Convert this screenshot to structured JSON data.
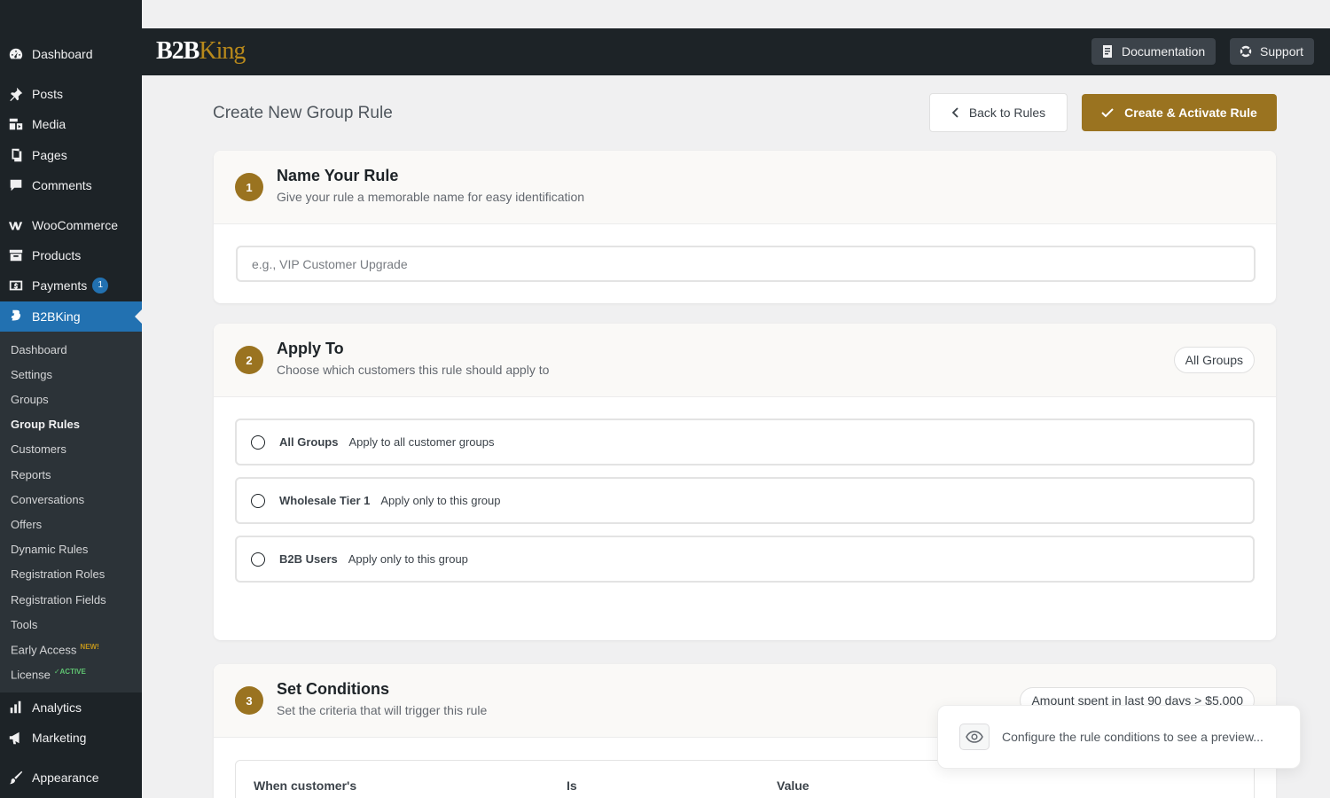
{
  "sidebar": {
    "top_items": [
      {
        "label": "Dashboard",
        "icon": "dashboard-icon"
      },
      {
        "label": "Posts",
        "icon": "pin-icon"
      },
      {
        "label": "Media",
        "icon": "media-icon"
      },
      {
        "label": "Pages",
        "icon": "pages-icon"
      },
      {
        "label": "Comments",
        "icon": "comment-icon"
      },
      {
        "label": "WooCommerce",
        "icon": "woo-icon"
      },
      {
        "label": "Products",
        "icon": "archive-icon"
      },
      {
        "label": "Payments",
        "icon": "payments-icon",
        "badge": "1"
      },
      {
        "label": "B2BKing",
        "icon": "b2bking-icon"
      }
    ],
    "submenu": [
      "Dashboard",
      "Settings",
      "Groups",
      "Group Rules",
      "Customers",
      "Reports",
      "Conversations",
      "Offers",
      "Dynamic Rules",
      "Registration Roles",
      "Registration Fields",
      "Tools",
      "Early Access",
      "License"
    ],
    "early_access_tag": "NEW!",
    "license_tag": "✓ACTIVE",
    "bottom_items": [
      {
        "label": "Analytics",
        "icon": "chart-icon"
      },
      {
        "label": "Marketing",
        "icon": "megaphone-icon"
      },
      {
        "label": "Appearance",
        "icon": "brush-icon"
      }
    ]
  },
  "header": {
    "logo_b2b": "B2B",
    "logo_king": "King",
    "documentation": "Documentation",
    "support": "Support"
  },
  "page": {
    "title": "Create New Group Rule",
    "back_button": "Back to Rules",
    "create_button": "Create & Activate Rule"
  },
  "step1": {
    "number": "1",
    "title": "Name Your Rule",
    "subtitle": "Give your rule a memorable name for easy identification",
    "placeholder": "e.g., VIP Customer Upgrade",
    "value": ""
  },
  "step2": {
    "number": "2",
    "title": "Apply To",
    "subtitle": "Choose which customers this rule should apply to",
    "pill": "All Groups",
    "options": [
      {
        "name": "All Groups",
        "desc": "Apply to all customer groups"
      },
      {
        "name": "Wholesale Tier 1",
        "desc": "Apply only to this group"
      },
      {
        "name": "B2B Users",
        "desc": "Apply only to this group"
      }
    ]
  },
  "step3": {
    "number": "3",
    "title": "Set Conditions",
    "subtitle": "Set the criteria that will trigger this rule",
    "pill": "Amount spent in last 90 days > $5,000",
    "columns": [
      "When customer's",
      "Is",
      "Value"
    ]
  },
  "preview": {
    "text": "Configure the rule conditions to see a preview..."
  },
  "colors": {
    "accent": "#9a7320",
    "sidebar_bg": "#1d2327",
    "active_menu": "#2271b1"
  }
}
